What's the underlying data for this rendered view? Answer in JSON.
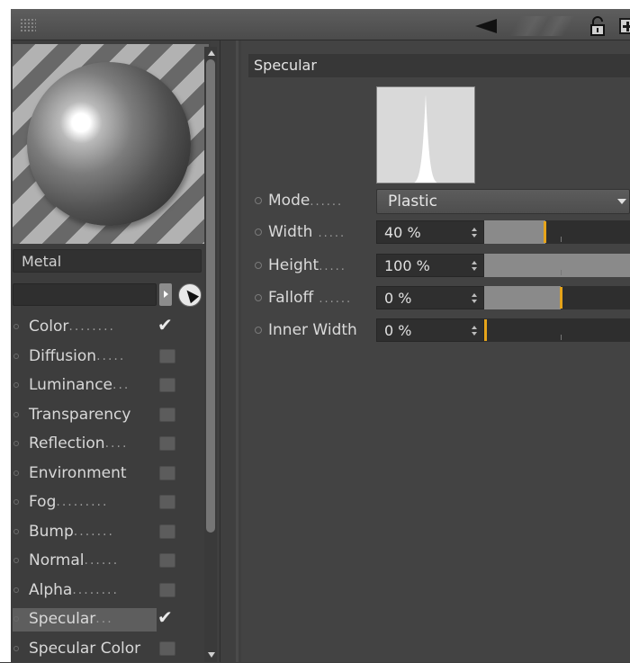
{
  "material": {
    "name": "Metal",
    "search_value": ""
  },
  "channels": [
    {
      "label": "Color",
      "enabled": true,
      "selected": false
    },
    {
      "label": "Diffusion",
      "enabled": false,
      "selected": false
    },
    {
      "label": "Luminance",
      "enabled": false,
      "selected": false
    },
    {
      "label": "Transparency",
      "enabled": false,
      "selected": false
    },
    {
      "label": "Reflection",
      "enabled": false,
      "selected": false
    },
    {
      "label": "Environment",
      "enabled": false,
      "selected": false
    },
    {
      "label": "Fog",
      "enabled": false,
      "selected": false
    },
    {
      "label": "Bump",
      "enabled": false,
      "selected": false
    },
    {
      "label": "Normal",
      "enabled": false,
      "selected": false
    },
    {
      "label": "Alpha",
      "enabled": false,
      "selected": false
    },
    {
      "label": "Specular",
      "enabled": true,
      "selected": true
    },
    {
      "label": "Specular Color",
      "enabled": false,
      "selected": false
    }
  ],
  "specular": {
    "title": "Specular",
    "mode": {
      "label": "Mode",
      "value": "Plastic"
    },
    "params": [
      {
        "label": "Width",
        "value": "40 %",
        "level": 0.4
      },
      {
        "label": "Height",
        "value": "100 %",
        "level": 1.0
      },
      {
        "label": "Falloff",
        "value": "0 %",
        "level": 0.5
      },
      {
        "label": "Inner Width",
        "value": "0 %",
        "level": 0.0
      }
    ]
  },
  "icons": {
    "back": "back-arrow-icon",
    "lock": "lock-icon",
    "new_panel": "plus-icon",
    "picker": "pick-icon"
  },
  "colors": {
    "accent": "#e6a41a",
    "panel": "#434343"
  }
}
